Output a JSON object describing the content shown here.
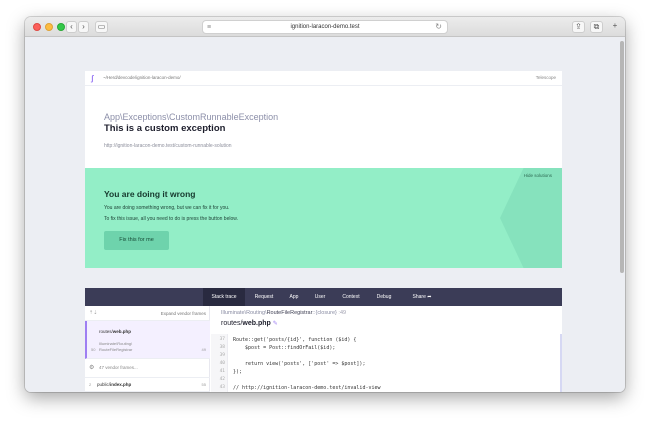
{
  "browser": {
    "url": "ignition-laracon-demo.test"
  },
  "header": {
    "path": "~/Herd/devcode/ignition-laracon-demo/",
    "telescope_label": "Telescope"
  },
  "exception": {
    "class": "App\\Exceptions\\CustomRunnableException",
    "message": "This is a custom exception",
    "url": "http://ignition-laracon-demo.test/custom-runnable-solution"
  },
  "solution": {
    "hide_label": "Hide solutions",
    "title": "You are doing it wrong",
    "line1": "You are doing something wrong, but we can fix it for you.",
    "line2": "To fix this issue, all you need to do is press the button below.",
    "button_label": "Fix this for me"
  },
  "tabs": [
    "Stack trace",
    "Request",
    "App",
    "User",
    "Context",
    "Debug",
    "Share"
  ],
  "frames": {
    "expand_label": "Expand vendor frames",
    "first": {
      "dir": "routes/",
      "file": "web.php",
      "namespace": "Illuminate\\Routing\\",
      "function": "RouteFileRegistrar",
      "index": "50",
      "line": "49"
    },
    "vendor_label": "47 vendor frames...",
    "last": {
      "index": "2",
      "dir": "public/",
      "file": "index.php",
      "line": "55"
    }
  },
  "code": {
    "class_prefix": "Illuminate\\Routing\\",
    "class_name": "RouteFileRegistrar",
    "method": "::{closure}",
    "line_ref": ":49",
    "file_dir": "routes/",
    "file_name": "web.php",
    "line_numbers": [
      "37",
      "38",
      "39",
      "40",
      "41",
      "42",
      "43"
    ],
    "lines": [
      "Route::get('posts/{id}', function ($id) {",
      "    $post = Post::findOrFail($id);",
      "",
      "    return view('posts', ['post' => $post]);",
      "});",
      "",
      "// http://ignition-laracon-demo.test/invalid-view"
    ]
  }
}
